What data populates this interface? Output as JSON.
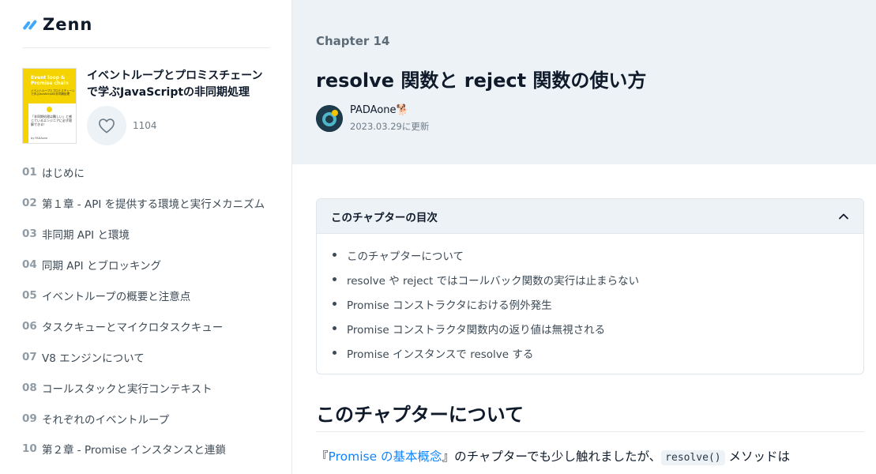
{
  "logo": {
    "text": "Zenn"
  },
  "book": {
    "title": "イベントループとプロミスチェーンで学ぶJavaScriptの非同期処理",
    "like_count": "1104",
    "cover_title": "Event loop & Promise chain",
    "cover_subtitle": "イベントループとプロミスチェーンで学ぶJavaScriptの非同期処理",
    "cover_body": "「非同期処理は難しい」と感じているエンジニアに必ず理解できる！",
    "cover_author": "by PADAone"
  },
  "sidebar": {
    "items": [
      {
        "num": "01",
        "label": "はじめに"
      },
      {
        "num": "02",
        "label": "第１章 - API を提供する環境と実行メカニズム"
      },
      {
        "num": "03",
        "label": "非同期 API と環境"
      },
      {
        "num": "04",
        "label": "同期 API とブロッキング"
      },
      {
        "num": "05",
        "label": "イベントループの概要と注意点"
      },
      {
        "num": "06",
        "label": "タスクキューとマイクロタスクキュー"
      },
      {
        "num": "07",
        "label": "V8 エンジンについて"
      },
      {
        "num": "08",
        "label": "コールスタックと実行コンテキスト"
      },
      {
        "num": "09",
        "label": "それぞれのイベントループ"
      },
      {
        "num": "10",
        "label": "第２章 - Promise インスタンスと連鎖"
      }
    ]
  },
  "header": {
    "chapter_label": "Chapter 14",
    "title": "resolve 関数と reject 関数の使い方",
    "author": "PADAone🐕",
    "updated": "2023.03.29に更新"
  },
  "chapter_toc": {
    "title": "このチャプターの目次",
    "items": [
      "このチャプターについて",
      "resolve や reject ではコールバック関数の実行は止まらない",
      "Promise コンストラクタにおける例外発生",
      "Promise コンストラクタ関数内の返り値は無視される",
      "Promise インスタンスで resolve する"
    ]
  },
  "content": {
    "section_title": "このチャプターについて",
    "para_open": "『",
    "para_link": "Promise の基本概念",
    "para_mid": "』のチャプターでも少し触れましたが、",
    "para_code": "resolve()",
    "para_end": " メソッドは"
  },
  "colors": {
    "accent": "#3ea8ff",
    "link": "#0f83fd",
    "header_bg": "#edf2f7"
  }
}
